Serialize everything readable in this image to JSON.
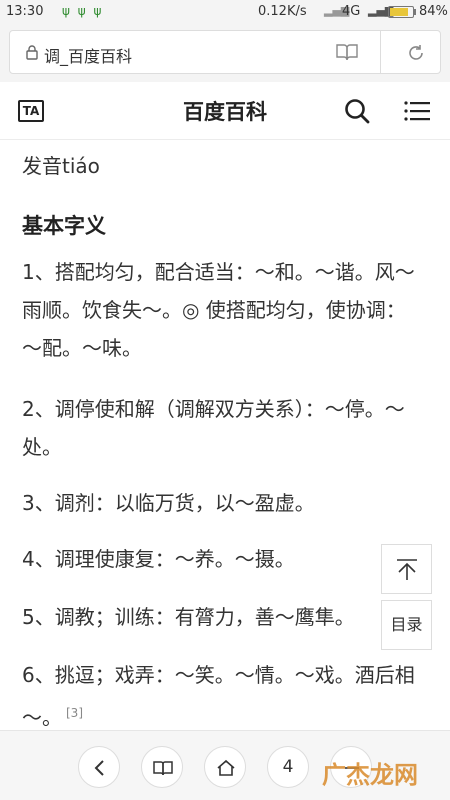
{
  "status_bar": {
    "time": "13:30",
    "app_icons": "ψ ψ ψ",
    "speed": "0.12K/s",
    "network": "4G",
    "battery_percent": "84%",
    "battery_level": 0.84
  },
  "address_bar": {
    "url_text": "调_百度百科"
  },
  "header": {
    "ta_label": "TA",
    "title": "百度百科"
  },
  "article": {
    "pronunciation": "发音tiáo",
    "section_title": "基本字义",
    "definitions": [
      "1、搭配均匀，配合适当：～和。～谐。风～雨顺。饮食失～。◎ 使搭配均匀，使协调：～配。～味。",
      "2、调停使和解（调解双方关系）：～停。～处。",
      "3、调剂：以临万货，以～盈虚。",
      "4、调理使康复：～养。～摄。",
      "5、调教；训练：有膂力，善～鹰隼。",
      "6、挑逗；戏弄：～笑。～情。～戏。酒后相～。"
    ],
    "citation": "[3]"
  },
  "float_buttons": {
    "toc_label": "目录"
  },
  "bottom_bar": {
    "tab_count": "4"
  },
  "watermark": "广杰龙网",
  "colors": {
    "accent_orange": "#d98a2b",
    "status_icons": "#2e8b2e",
    "battery_fill": "#e8c63a"
  }
}
